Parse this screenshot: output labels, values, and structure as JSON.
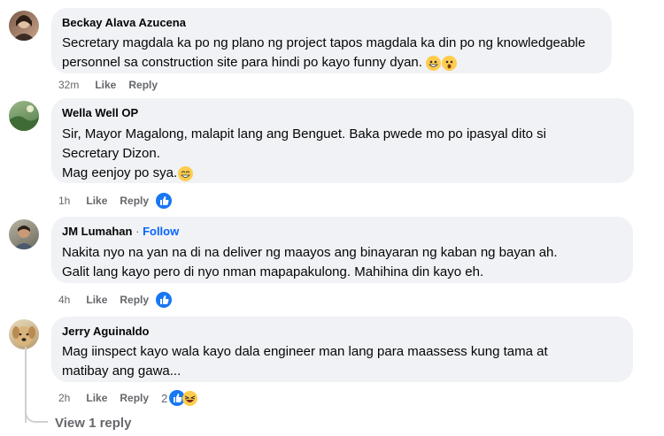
{
  "comments": [
    {
      "author": "Beckay Alava Azucena",
      "text": "Secretary magdala ka po ng plano ng project tapos magdala ka din po ng knowledgeable personnel sa construction site para hindi po kayo funny dyan.",
      "time": "32m",
      "like": "Like",
      "reply": "Reply"
    },
    {
      "author": "Wella Well OP",
      "text_lines": [
        "Sir, Mayor Magalong, malapit lang ang Benguet. Baka pwede mo po ipasyal dito si",
        "Secretary Dizon.",
        "Mag eenjoy po sya."
      ],
      "time": "1h",
      "like": "Like",
      "reply": "Reply"
    },
    {
      "author": "JM Lumahan",
      "separator": "·",
      "follow": "Follow",
      "text_lines": [
        "Nakita nyo na yan na di na deliver ng maayos ang binayaran ng kaban ng bayan ah.",
        "Galit lang kayo pero di nyo nman mapapakulong. Mahihina din kayo eh."
      ],
      "time": "4h",
      "like": "Like",
      "reply": "Reply"
    },
    {
      "author": "Jerry Aguinaldo",
      "text_lines": [
        "Mag iinspect kayo wala kayo dala engineer man lang para maassess kung tama at",
        "matibay ang gawa..."
      ],
      "time": "2h",
      "like": "Like",
      "reply": "Reply",
      "reaction_count": "2"
    }
  ],
  "view_replies": "View 1 reply",
  "colors": {
    "bubble": "#f0f2f5",
    "meta": "#65676b",
    "link": "#0866ff",
    "like_blue": "#1877f2"
  }
}
